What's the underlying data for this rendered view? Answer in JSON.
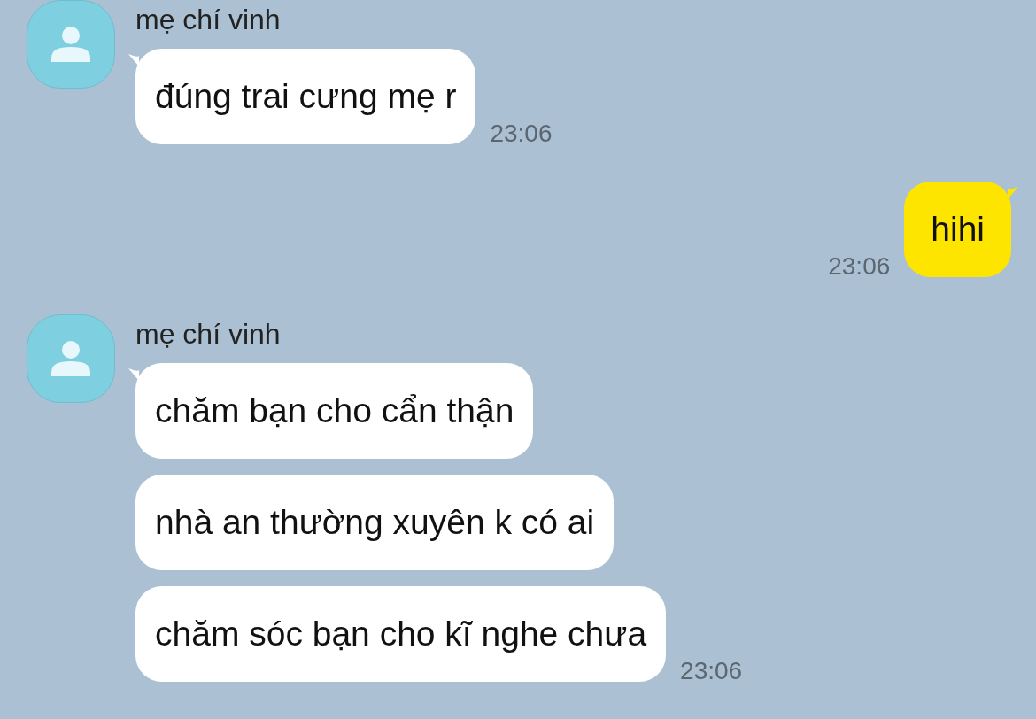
{
  "messages": [
    {
      "kind": "incoming",
      "sender": "mẹ chí vinh",
      "bubbles": [
        {
          "text": "đúng trai cưng mẹ r",
          "time": "23:06"
        }
      ]
    },
    {
      "kind": "outgoing",
      "bubbles": [
        {
          "text": "hihi",
          "time": "23:06"
        }
      ]
    },
    {
      "kind": "incoming",
      "sender": "mẹ chí vinh",
      "bubbles": [
        {
          "text": "chăm bạn cho cẩn thận"
        },
        {
          "text": "nhà an thường xuyên k có ai"
        },
        {
          "text": "chăm sóc bạn cho kĩ nghe chưa",
          "time": "23:06"
        }
      ]
    }
  ]
}
